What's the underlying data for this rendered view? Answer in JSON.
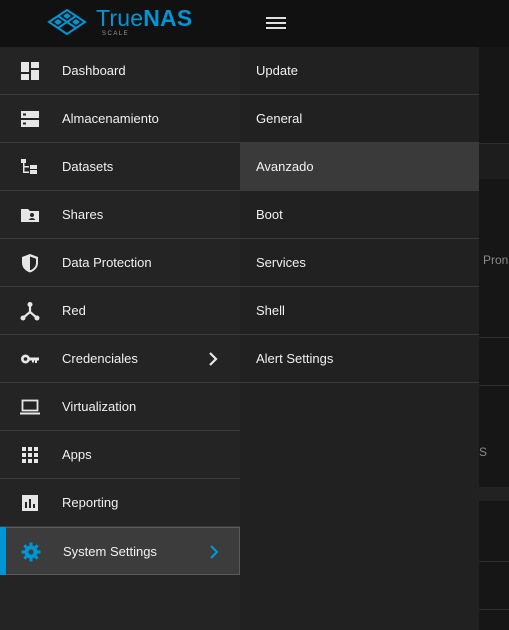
{
  "app": {
    "brand_true": "True",
    "brand_nas": "NAS",
    "brand_sub": "SCALE"
  },
  "colors": {
    "accent": "#0095d5",
    "sidebar_bg": "#242424",
    "topbar_bg": "#111111"
  },
  "sidebar": {
    "items": [
      {
        "label": "Dashboard",
        "icon": "dashboard-icon"
      },
      {
        "label": "Almacenamiento",
        "icon": "storage-icon"
      },
      {
        "label": "Datasets",
        "icon": "datasets-icon"
      },
      {
        "label": "Shares",
        "icon": "shares-folder-icon"
      },
      {
        "label": "Data Protection",
        "icon": "shield-icon"
      },
      {
        "label": "Red",
        "icon": "network-icon"
      },
      {
        "label": "Credenciales",
        "icon": "key-icon"
      },
      {
        "label": "Virtualization",
        "icon": "laptop-icon"
      },
      {
        "label": "Apps",
        "icon": "apps-grid-icon"
      },
      {
        "label": "Reporting",
        "icon": "reporting-chart-icon"
      },
      {
        "label": "System Settings",
        "icon": "gear-icon"
      }
    ],
    "active": "System Settings"
  },
  "submenu": {
    "items": [
      {
        "label": "Update"
      },
      {
        "label": "General"
      },
      {
        "label": "Avanzado"
      },
      {
        "label": "Boot"
      },
      {
        "label": "Services"
      },
      {
        "label": "Shell"
      },
      {
        "label": "Alert Settings"
      }
    ],
    "active": "Avanzado"
  },
  "background": {
    "text_1": "d Pron",
    "text_2": "S"
  }
}
